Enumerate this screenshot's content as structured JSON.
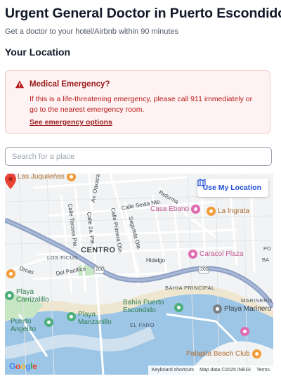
{
  "header": {
    "title": "Urgent General Doctor in Puerto Escondido",
    "subtitle": "Get a doctor to your hotel/Airbnb within 90 minutes"
  },
  "location_section": {
    "heading": "Your Location"
  },
  "emergency_alert": {
    "title": "Medical Emergency?",
    "body": "If this is a life-threatening emergency, please call 911 immediately or go to the nearest emergency room.",
    "link_label": "See emergency options",
    "icon": "warning-triangle-icon",
    "background_color": "#fef2f2",
    "text_color": "#b91c1c"
  },
  "search": {
    "value": "",
    "placeholder": "Search for a place"
  },
  "map": {
    "use_location_label": "Use My Location",
    "logo": "Google",
    "attribution": {
      "shortcuts": "Keyboard shortcuts",
      "map_data": "Map data ©2025 INEGI",
      "terms": "Terms"
    },
    "places": {
      "juquilenas": "Las Juquileñas",
      "casa_ebano": "Casa Ébano",
      "la_ingrata": "La Ingrata",
      "caracol_plaza": "Caracol Plaza",
      "playa_carrizalillo": "Playa Carrizalillo",
      "puerto_angelito": "Puerto Angelito",
      "playa_manzanillo": "Playa Manzanillo",
      "bahia_puerto_escondido": "Bahía Puerto Escondido",
      "playa_marinero": "Playa Marinero",
      "palapita": "Palapita Beach Club"
    },
    "areas": {
      "centro": "CENTRO",
      "los_ficus": "LOS FICUS",
      "bahia_principal": "BAHIA PRINCIPAL",
      "marinero": "MARINERO",
      "el_faro": "EL FARO",
      "ba": "BA",
      "po": "PO"
    },
    "streets": {
      "oaxaca": "Av. Oaxaca",
      "sexta_nte": "Calle Sexta Nte.",
      "reforma": "Reforma",
      "tercera_pte": "Calle Tercera Pte.",
      "segunda_pte": "Calle 2a. Pte.",
      "primera_ote": "Calle Primera Ote.",
      "segunda_ote": "Segunda Ote.",
      "hidalgo": "Hidalgo",
      "del_pacifico": "Del Pacífico",
      "orcas": "Orcas"
    },
    "highway_shield": "200",
    "colors": {
      "highway": "#8da0c4",
      "water": "#9cc5e6",
      "park": "#c7e6c3",
      "button_text": "#1d4ed8"
    }
  }
}
